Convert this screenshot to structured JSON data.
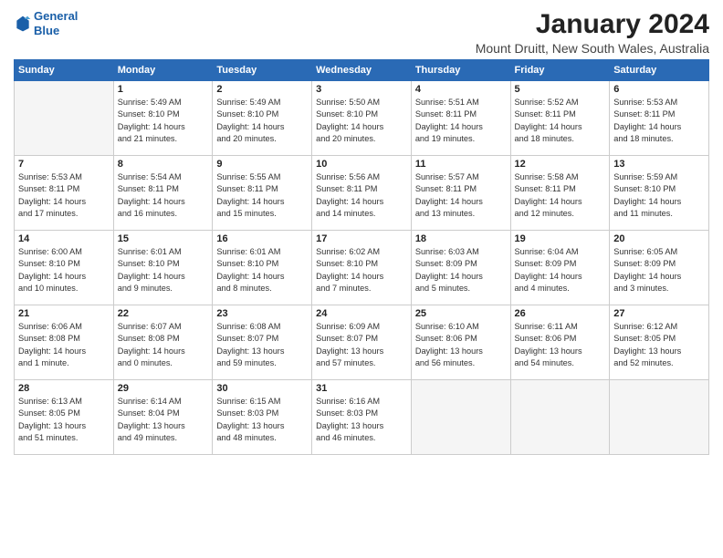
{
  "logo": {
    "line1": "General",
    "line2": "Blue"
  },
  "title": "January 2024",
  "subtitle": "Mount Druitt, New South Wales, Australia",
  "days_header": [
    "Sunday",
    "Monday",
    "Tuesday",
    "Wednesday",
    "Thursday",
    "Friday",
    "Saturday"
  ],
  "weeks": [
    [
      {
        "num": "",
        "info": ""
      },
      {
        "num": "1",
        "info": "Sunrise: 5:49 AM\nSunset: 8:10 PM\nDaylight: 14 hours\nand 21 minutes."
      },
      {
        "num": "2",
        "info": "Sunrise: 5:49 AM\nSunset: 8:10 PM\nDaylight: 14 hours\nand 20 minutes."
      },
      {
        "num": "3",
        "info": "Sunrise: 5:50 AM\nSunset: 8:10 PM\nDaylight: 14 hours\nand 20 minutes."
      },
      {
        "num": "4",
        "info": "Sunrise: 5:51 AM\nSunset: 8:11 PM\nDaylight: 14 hours\nand 19 minutes."
      },
      {
        "num": "5",
        "info": "Sunrise: 5:52 AM\nSunset: 8:11 PM\nDaylight: 14 hours\nand 18 minutes."
      },
      {
        "num": "6",
        "info": "Sunrise: 5:53 AM\nSunset: 8:11 PM\nDaylight: 14 hours\nand 18 minutes."
      }
    ],
    [
      {
        "num": "7",
        "info": "Sunrise: 5:53 AM\nSunset: 8:11 PM\nDaylight: 14 hours\nand 17 minutes."
      },
      {
        "num": "8",
        "info": "Sunrise: 5:54 AM\nSunset: 8:11 PM\nDaylight: 14 hours\nand 16 minutes."
      },
      {
        "num": "9",
        "info": "Sunrise: 5:55 AM\nSunset: 8:11 PM\nDaylight: 14 hours\nand 15 minutes."
      },
      {
        "num": "10",
        "info": "Sunrise: 5:56 AM\nSunset: 8:11 PM\nDaylight: 14 hours\nand 14 minutes."
      },
      {
        "num": "11",
        "info": "Sunrise: 5:57 AM\nSunset: 8:11 PM\nDaylight: 14 hours\nand 13 minutes."
      },
      {
        "num": "12",
        "info": "Sunrise: 5:58 AM\nSunset: 8:11 PM\nDaylight: 14 hours\nand 12 minutes."
      },
      {
        "num": "13",
        "info": "Sunrise: 5:59 AM\nSunset: 8:10 PM\nDaylight: 14 hours\nand 11 minutes."
      }
    ],
    [
      {
        "num": "14",
        "info": "Sunrise: 6:00 AM\nSunset: 8:10 PM\nDaylight: 14 hours\nand 10 minutes."
      },
      {
        "num": "15",
        "info": "Sunrise: 6:01 AM\nSunset: 8:10 PM\nDaylight: 14 hours\nand 9 minutes."
      },
      {
        "num": "16",
        "info": "Sunrise: 6:01 AM\nSunset: 8:10 PM\nDaylight: 14 hours\nand 8 minutes."
      },
      {
        "num": "17",
        "info": "Sunrise: 6:02 AM\nSunset: 8:10 PM\nDaylight: 14 hours\nand 7 minutes."
      },
      {
        "num": "18",
        "info": "Sunrise: 6:03 AM\nSunset: 8:09 PM\nDaylight: 14 hours\nand 5 minutes."
      },
      {
        "num": "19",
        "info": "Sunrise: 6:04 AM\nSunset: 8:09 PM\nDaylight: 14 hours\nand 4 minutes."
      },
      {
        "num": "20",
        "info": "Sunrise: 6:05 AM\nSunset: 8:09 PM\nDaylight: 14 hours\nand 3 minutes."
      }
    ],
    [
      {
        "num": "21",
        "info": "Sunrise: 6:06 AM\nSunset: 8:08 PM\nDaylight: 14 hours\nand 1 minute."
      },
      {
        "num": "22",
        "info": "Sunrise: 6:07 AM\nSunset: 8:08 PM\nDaylight: 14 hours\nand 0 minutes."
      },
      {
        "num": "23",
        "info": "Sunrise: 6:08 AM\nSunset: 8:07 PM\nDaylight: 13 hours\nand 59 minutes."
      },
      {
        "num": "24",
        "info": "Sunrise: 6:09 AM\nSunset: 8:07 PM\nDaylight: 13 hours\nand 57 minutes."
      },
      {
        "num": "25",
        "info": "Sunrise: 6:10 AM\nSunset: 8:06 PM\nDaylight: 13 hours\nand 56 minutes."
      },
      {
        "num": "26",
        "info": "Sunrise: 6:11 AM\nSunset: 8:06 PM\nDaylight: 13 hours\nand 54 minutes."
      },
      {
        "num": "27",
        "info": "Sunrise: 6:12 AM\nSunset: 8:05 PM\nDaylight: 13 hours\nand 52 minutes."
      }
    ],
    [
      {
        "num": "28",
        "info": "Sunrise: 6:13 AM\nSunset: 8:05 PM\nDaylight: 13 hours\nand 51 minutes."
      },
      {
        "num": "29",
        "info": "Sunrise: 6:14 AM\nSunset: 8:04 PM\nDaylight: 13 hours\nand 49 minutes."
      },
      {
        "num": "30",
        "info": "Sunrise: 6:15 AM\nSunset: 8:03 PM\nDaylight: 13 hours\nand 48 minutes."
      },
      {
        "num": "31",
        "info": "Sunrise: 6:16 AM\nSunset: 8:03 PM\nDaylight: 13 hours\nand 46 minutes."
      },
      {
        "num": "",
        "info": ""
      },
      {
        "num": "",
        "info": ""
      },
      {
        "num": "",
        "info": ""
      }
    ]
  ]
}
